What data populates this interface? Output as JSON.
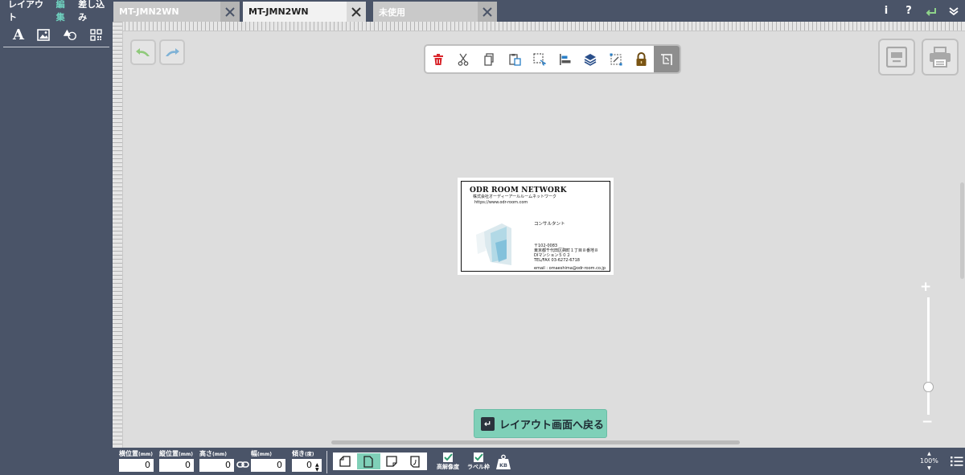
{
  "sidebar": {
    "tabs": [
      {
        "label": "レイアウト",
        "active": false
      },
      {
        "label": "編集",
        "active": true
      },
      {
        "label": "差し込み",
        "active": false
      }
    ],
    "tools": [
      "text-icon",
      "image-icon",
      "shapes-icon",
      "qr-code-icon"
    ],
    "text_tool_label": "A"
  },
  "tabs": [
    {
      "label": "MT-JMN2WN",
      "active": false
    },
    {
      "label": "MT-JMN2WN",
      "active": true
    },
    {
      "label": "未使用",
      "active": false
    }
  ],
  "top_icons": {
    "info": "i",
    "help": "?"
  },
  "edit_toolbar": [
    "delete-icon",
    "cut-icon",
    "copy-icon",
    "paste-icon",
    "select-area-icon",
    "align-icon",
    "layers-icon",
    "group-icon",
    "lock-icon",
    "rotate-icon"
  ],
  "card": {
    "logo": "ODR ROOM NETWORK",
    "company": "株式会社オーディーアールルームネットワーク",
    "url": "https://www.odr-room.com",
    "title": "コンサルタント",
    "postal": "〒102-0083",
    "address1": "東京都千代田区麹町１丁目８番地８",
    "address2": "DIマンション５０２",
    "tel": "TEL/FAX 03-6272-6718",
    "email": "email : omaeshima@odr-room.co.jp"
  },
  "back_button": {
    "label": "レイアウト画面へ戻る"
  },
  "bottom": {
    "fields": [
      {
        "label": "横位置",
        "unit": "(mm)",
        "value": "0"
      },
      {
        "label": "縦位置",
        "unit": "(mm)",
        "value": "0"
      },
      {
        "label": "高さ",
        "unit": "(mm)",
        "value": "0"
      },
      {
        "label": "幅",
        "unit": "(mm)",
        "value": "0"
      },
      {
        "label": "傾き",
        "unit": "(度)",
        "value": "0"
      }
    ],
    "checks": [
      {
        "label": "高解像度",
        "checked": true
      },
      {
        "label": "ラベル枠",
        "checked": true
      }
    ],
    "kb_label": "KB",
    "zoom": "100%"
  },
  "colors": {
    "accent": "#7fd0b8",
    "chrome": "#4a5468",
    "canvas": "#dddddd",
    "delete": "#d9262c"
  }
}
